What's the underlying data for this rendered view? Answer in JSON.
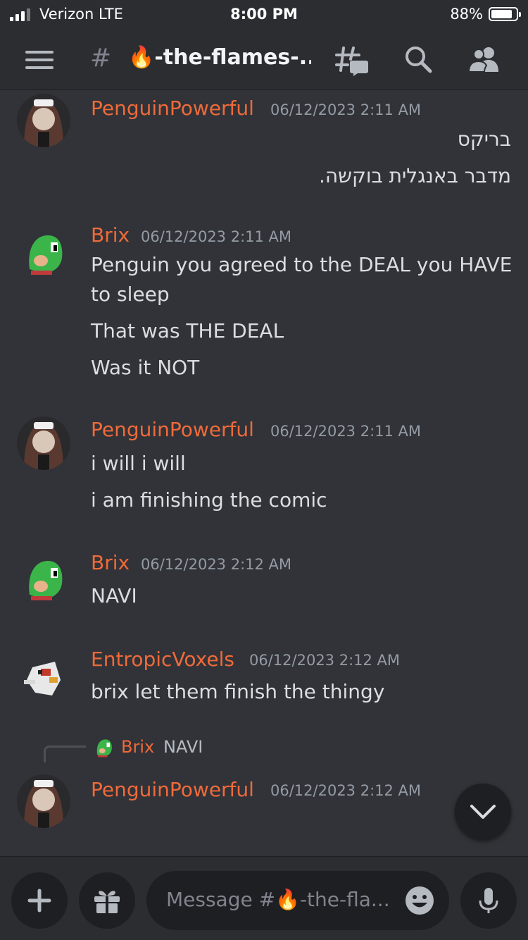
{
  "status_bar": {
    "carrier": "Verizon  LTE",
    "time": "8:00 PM",
    "battery": "88%"
  },
  "header": {
    "hash": "#",
    "channel_name": "🔥-the-flames-...",
    "icons": [
      "menu-icon",
      "threads-icon",
      "search-icon",
      "members-icon"
    ]
  },
  "messages": [
    {
      "author": "PenguinPowerful",
      "timestamp": "06/12/2023 2:11 AM",
      "lines": [
        "בריקס",
        "מדבר באנגלית בוקשה."
      ]
    },
    {
      "author": "Brix",
      "timestamp": "06/12/2023 2:11 AM",
      "lines": [
        "Penguin you agreed to the DEAL you HAVE",
        "to sleep",
        "That was THE DEAL",
        "Was it NOT"
      ]
    },
    {
      "author": "PenguinPowerful",
      "timestamp": "06/12/2023 2:11 AM",
      "lines": [
        "i will i will",
        "i am finishing the comic"
      ]
    },
    {
      "author": "Brix",
      "timestamp": "06/12/2023 2:12 AM",
      "lines": [
        "NAVI"
      ]
    },
    {
      "author": "EntropicVoxels",
      "timestamp": "06/12/2023 2:12 AM",
      "lines": [
        "brix let them finish the thingy"
      ]
    },
    {
      "author": "PenguinPowerful",
      "timestamp": "06/12/2023 2:12 AM",
      "lines": []
    }
  ],
  "reply": {
    "author": "Brix",
    "text": "NAVI"
  },
  "composer": {
    "placeholder": "Message #🔥-the-fla..."
  },
  "colors": {
    "background": "#313338",
    "header": "#2b2d31",
    "author": "#ef6a3a",
    "text": "#dbdee1",
    "muted": "#949ba4"
  }
}
